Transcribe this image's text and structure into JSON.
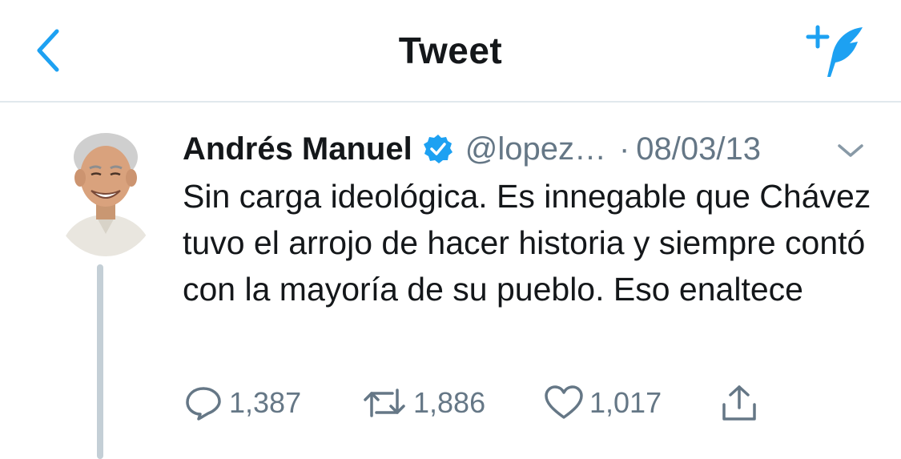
{
  "header": {
    "title": "Tweet",
    "back_icon": "chevron-left-icon",
    "compose_icon": "compose-tweet-icon"
  },
  "tweet": {
    "author_name": "Andrés Manuel",
    "handle": "@lopez…",
    "separator": "·",
    "date": "08/03/13",
    "text": "Sin carga ideológica. Es innegable que Chávez tuvo el arrojo de hacer historia y siempre contó con la mayoría de su pueblo. Eso enaltece",
    "verified_icon": "verified-badge-icon",
    "menu_icon": "chevron-down-icon"
  },
  "actions": {
    "replies": "1,387",
    "retweets": "1,886",
    "likes": "1,017"
  },
  "colors": {
    "accent": "#1da1f2",
    "text": "#14171a",
    "secondary": "#657786",
    "divider": "#e1e8ed",
    "thread_line": "#c4cfd6"
  }
}
